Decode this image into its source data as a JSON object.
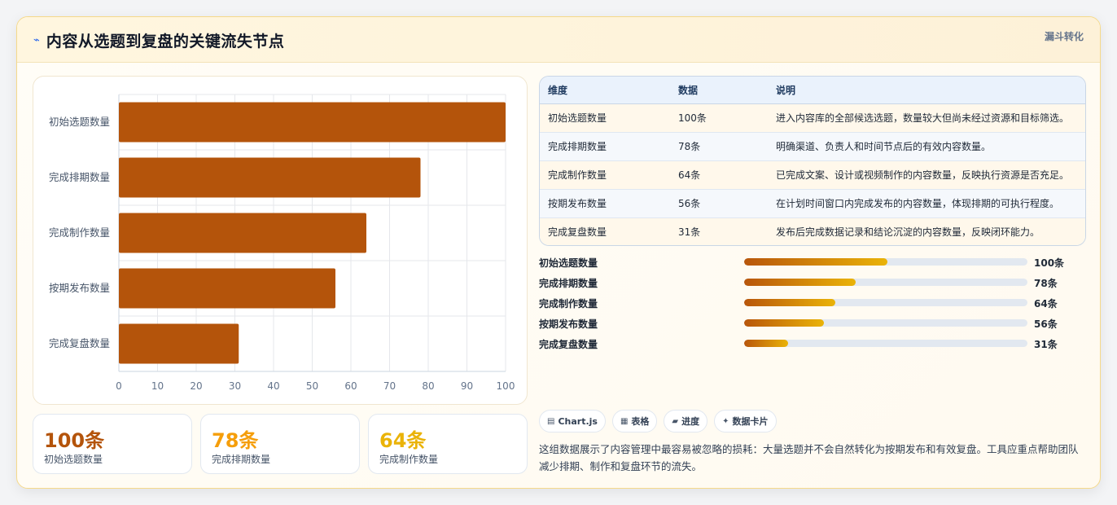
{
  "header": {
    "title_icon": "trend-icon",
    "title": "内容从选题到复盘的关键流失节点",
    "tag": "漏斗转化"
  },
  "chart_data": {
    "type": "bar",
    "orientation": "horizontal",
    "categories": [
      "初始选题数量",
      "完成排期数量",
      "完成制作数量",
      "按期发布数量",
      "完成复盘数量"
    ],
    "values": [
      100,
      78,
      64,
      56,
      31
    ],
    "xlim": [
      0,
      100
    ],
    "xticks": [
      0,
      10,
      20,
      30,
      40,
      50,
      60,
      70,
      80,
      90,
      100
    ],
    "grid": true,
    "legend": "none",
    "bar_color": "#b4540b"
  },
  "table": {
    "headers": [
      "维度",
      "数据",
      "说明"
    ],
    "rows": [
      [
        "初始选题数量",
        "100条",
        "进入内容库的全部候选选题，数量较大但尚未经过资源和目标筛选。"
      ],
      [
        "完成排期数量",
        "78条",
        "明确渠道、负责人和时间节点后的有效内容数量。"
      ],
      [
        "完成制作数量",
        "64条",
        "已完成文案、设计或视频制作的内容数量，反映执行资源是否充足。"
      ],
      [
        "按期发布数量",
        "56条",
        "在计划时间窗口内完成发布的内容数量，体现排期的可执行程度。"
      ],
      [
        "完成复盘数量",
        "31条",
        "发布后完成数据记录和结论沉淀的内容数量，反映闭环能力。"
      ]
    ]
  },
  "progress": [
    {
      "label": "初始选题数量",
      "value": "100条",
      "fraction": 0.505
    },
    {
      "label": "完成排期数量",
      "value": "78条",
      "fraction": 0.393
    },
    {
      "label": "完成制作数量",
      "value": "64条",
      "fraction": 0.323
    },
    {
      "label": "按期发布数量",
      "value": "56条",
      "fraction": 0.282
    },
    {
      "label": "完成复盘数量",
      "value": "31条",
      "fraction": 0.156
    }
  ],
  "stats": [
    {
      "value": "100条",
      "label": "初始选题数量",
      "color": "#b4540b"
    },
    {
      "value": "78条",
      "label": "完成排期数量",
      "color": "#f59e0b"
    },
    {
      "value": "64条",
      "label": "完成制作数量",
      "color": "#eab308"
    }
  ],
  "chips": [
    {
      "icon": "chart-icon",
      "glyph": "▤",
      "label": "Chart.js"
    },
    {
      "icon": "table-icon",
      "glyph": "▦",
      "label": "表格"
    },
    {
      "icon": "progress-icon",
      "glyph": "▰",
      "label": "进度"
    },
    {
      "icon": "sparkle-icon",
      "glyph": "✦",
      "label": "数据卡片"
    }
  ],
  "summary": "这组数据展示了内容管理中最容易被忽略的损耗：大量选题并不会自然转化为按期发布和有效复盘。工具应重点帮助团队减少排期、制作和复盘环节的流失。"
}
